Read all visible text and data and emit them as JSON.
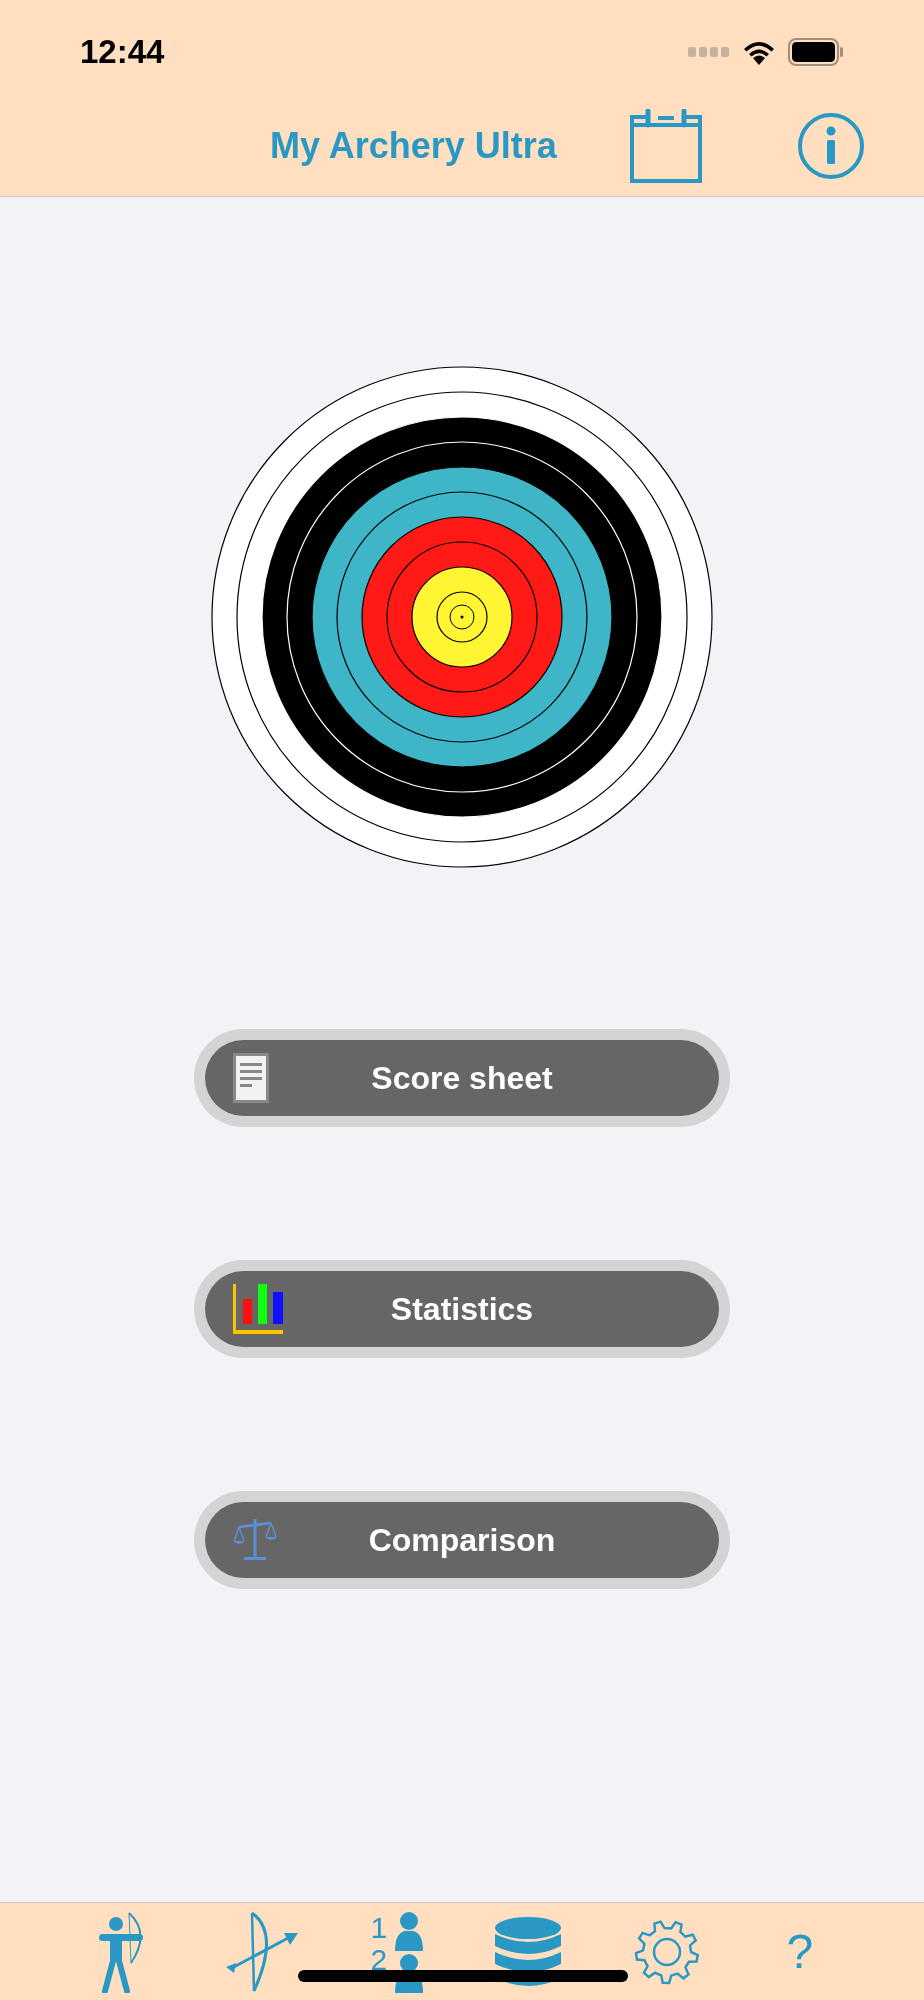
{
  "status_bar": {
    "time": "12:44"
  },
  "nav_bar": {
    "title": "My Archery Ultra"
  },
  "menu_buttons": [
    {
      "label": "Score sheet",
      "kind": "sheet"
    },
    {
      "label": "Statistics",
      "kind": "chart"
    },
    {
      "label": "Comparison",
      "kind": "scale"
    }
  ],
  "tab_bar": {
    "items": [
      {
        "kind": "archer"
      },
      {
        "kind": "bow"
      },
      {
        "kind": "ranking",
        "digits": [
          "1",
          "2"
        ]
      },
      {
        "kind": "database"
      },
      {
        "kind": "settings"
      },
      {
        "kind": "help",
        "glyph": "?"
      }
    ]
  }
}
